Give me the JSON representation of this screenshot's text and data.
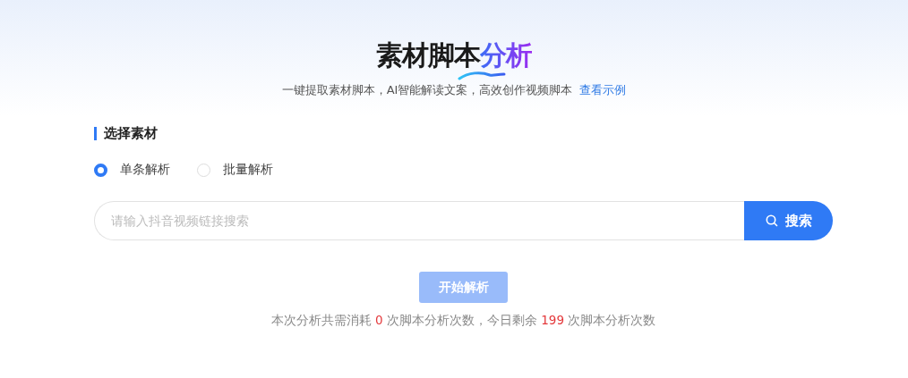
{
  "header": {
    "title": "素材脚本",
    "title_highlight": "分析",
    "subtitle": "一键提取素材脚本，AI智能解读文案，高效创作视频脚本",
    "example_link": "查看示例"
  },
  "section": {
    "title": "选择素材"
  },
  "modes": [
    {
      "label": "单条解析",
      "selected": true
    },
    {
      "label": "批量解析",
      "selected": false
    }
  ],
  "search": {
    "placeholder": "请输入抖音视频链接搜索",
    "button": "搜索"
  },
  "start_button": {
    "label": "开始解析",
    "disabled": true
  },
  "usage": {
    "prefix": "本次分析共需消耗",
    "cost": "0",
    "middle": "次脚本分析次数，今日剩余",
    "remaining": "199",
    "suffix": "次脚本分析次数"
  }
}
